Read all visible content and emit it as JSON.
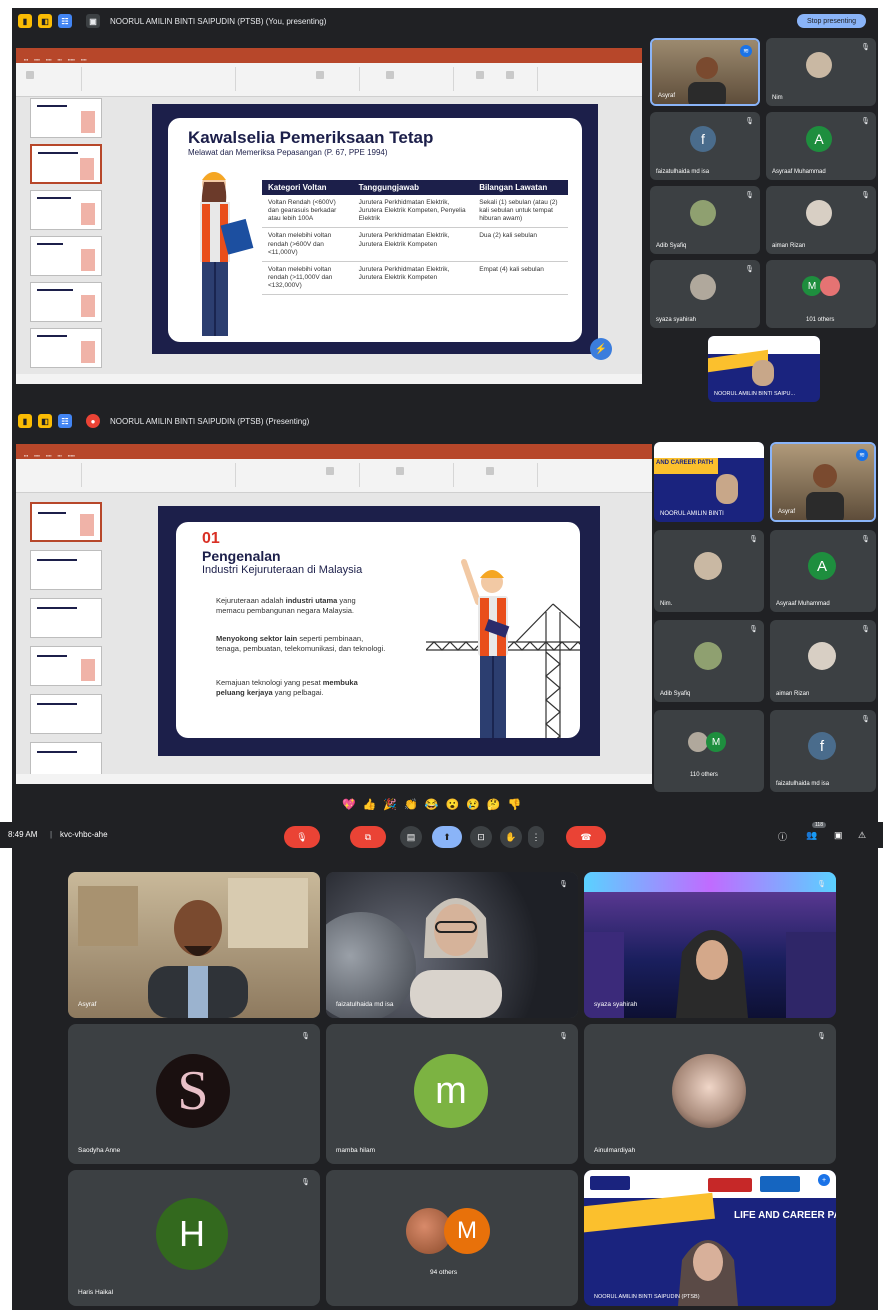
{
  "panel1": {
    "presenter_title": "NOORUL AMILIN BINTI SAIPUDIN (PTSB) (You, presenting)",
    "stop_button": "Stop presenting",
    "slide": {
      "title": "Kawalselia Pemeriksaan Tetap",
      "subtitle": "Melawat dan Memeriksa Pepasangan (P. 67, PPE 1994)",
      "table_headers": [
        "Kategori Voltan",
        "Tanggungjawab",
        "Bilangan Lawatan"
      ],
      "rows": [
        [
          "Voltan Rendah (<600V) dan gearasuis berkadar atau lebih 100A",
          "Jurutera Perkhidmatan Elektrik, Jurutera Elektrik Kompeten, Penyelia Elektrik",
          "Sekali (1) sebulan (atau (2) kali sebulan untuk tempat hiburan awam)"
        ],
        [
          "Voltan melebihi voltan rendah (>600V dan <11,000V)",
          "Jurutera Perkhidmatan Elektrik, Jurutera Elektrik Kompeten",
          "Dua (2) kali sebulan"
        ],
        [
          "Voltan melebihi voltan rendah (>11,000V dan <132,000V)",
          "Jurutera Perkhidmatan Elektrik, Jurutera Elektrik Kompeten",
          "Empat (4) kali sebulan"
        ]
      ]
    },
    "tiles": [
      {
        "name": "Asyraf",
        "kind": "photo"
      },
      {
        "name": "Nim",
        "kind": "photo"
      },
      {
        "name": "faizatulhaida md isa",
        "kind": "letter",
        "letter": "f",
        "color": "#4a6c8c"
      },
      {
        "name": "Asyraaf Muhammad",
        "kind": "letter",
        "letter": "A",
        "color": "#1e8e3e"
      },
      {
        "name": "Adib Syafiq",
        "kind": "photo"
      },
      {
        "name": "aiman Rizan",
        "kind": "photo"
      },
      {
        "name": "syaza syahirah",
        "kind": "photo"
      },
      {
        "name": "101 others",
        "kind": "group"
      }
    ],
    "thumb_name": "NOORUL AMILIN BINTI SAIPU..."
  },
  "panel2": {
    "presenter_title": "NOORUL AMILIN BINTI SAIPUDIN (PTSB) (Presenting)",
    "slide": {
      "number": "01",
      "title": "Pengenalan",
      "subtitle": "Industri Kejuruteraan di Malaysia",
      "p1_a": "Kejuruteraan adalah ",
      "p1_b": "industri utama",
      "p1_c": " yang memacu pembangunan negara Malaysia.",
      "p2_a": "Menyokong sektor lain",
      "p2_b": " seperti pembinaan, tenaga, pembuatan, telekomunikasi, dan teknologi.",
      "p3_a": "Kemajuan teknologi yang pesat ",
      "p3_b": "membuka peluang kerjaya",
      "p3_c": " yang pelbagai."
    },
    "tiles": [
      {
        "name": "NOORUL AMILIN BINTI",
        "kind": "banner"
      },
      {
        "name": "Asyraf",
        "kind": "photo"
      },
      {
        "name": "Nim.",
        "kind": "photo"
      },
      {
        "name": "Asyraaf Muhammad",
        "kind": "letter",
        "letter": "A",
        "color": "#1e8e3e"
      },
      {
        "name": "Adib Syafiq",
        "kind": "photo"
      },
      {
        "name": "aiman Rizan",
        "kind": "photo"
      },
      {
        "name": "110 others",
        "kind": "group"
      },
      {
        "name": "faizatulhaida md isa",
        "kind": "letter",
        "letter": "f",
        "color": "#4a6c8c"
      }
    ],
    "reactions": [
      "💖",
      "👍",
      "🎉",
      "👏",
      "😂",
      "😮",
      "😢",
      "🤔",
      "👎"
    ],
    "time": "8:49 AM",
    "meeting_code": "kvc-vhbc-ahe",
    "participant_count": "118"
  },
  "panel3": {
    "tiles": [
      {
        "name": "Asyraf",
        "kind": "video"
      },
      {
        "name": "faizatulhaida md isa",
        "kind": "video"
      },
      {
        "name": "syaza syahirah",
        "kind": "video"
      },
      {
        "name": "Saodyha Anne",
        "kind": "letter",
        "letter": "S",
        "color": "#1a1010"
      },
      {
        "name": "mamba hilam",
        "kind": "letter",
        "letter": "m",
        "color": "#7cb342"
      },
      {
        "name": "Ainulmardiyah",
        "kind": "photo"
      },
      {
        "name": "Haris Haikal",
        "kind": "letter",
        "letter": "H",
        "color": "#33691e"
      },
      {
        "name": "94 others",
        "kind": "group",
        "letter": "M",
        "color": "#e8710a"
      },
      {
        "name": "NOORUL AMILIN BINTI SAIPUDIN (PTSB)",
        "kind": "banner"
      }
    ],
    "banner_text": "LIFE AND CAREER PATH"
  },
  "colors": {
    "meet_bg": "#202124",
    "tile_bg": "#3c4043",
    "slide_navy": "#1c1f4a",
    "ppt_red": "#b7472a",
    "accent_red": "#d93025",
    "meet_blue": "#8ab4f8"
  }
}
